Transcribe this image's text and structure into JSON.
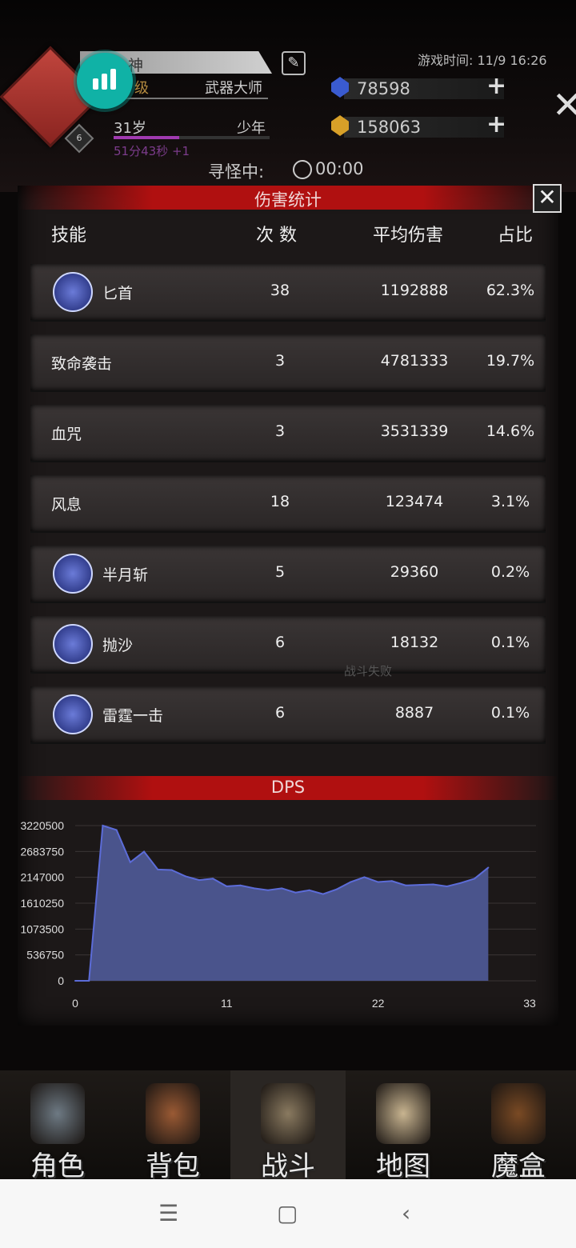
{
  "player": {
    "name": "神",
    "rank": "级",
    "class": "武器大师",
    "age": "31岁",
    "stage": "少年",
    "timer": "51分43秒 +1",
    "level_badge": "6",
    "xp_fraction": 0.42
  },
  "game_time": "游戏时间: 11/9 16:26",
  "resources": [
    {
      "value": "78598",
      "color": "#3a5bd0",
      "icon": "gem-icon"
    },
    {
      "value": "158063",
      "color": "#d8a028",
      "icon": "gold-icon"
    }
  ],
  "search": {
    "label": "寻怪中:",
    "time": "00:00"
  },
  "panel": {
    "title": "伤害统计",
    "headers": {
      "skill": "技能",
      "count": "次 数",
      "avg": "平均伤害",
      "pct": "占比"
    },
    "rows": [
      {
        "name": "匕首",
        "count": "38",
        "avg": "1192888",
        "pct": "62.3%",
        "icon": "dagger-icon"
      },
      {
        "name": "致命袭击",
        "count": "3",
        "avg": "4781333",
        "pct": "19.7%",
        "icon": ""
      },
      {
        "name": "血咒",
        "count": "3",
        "avg": "3531339",
        "pct": "14.6%",
        "icon": ""
      },
      {
        "name": "风息",
        "count": "18",
        "avg": "123474",
        "pct": "3.1%",
        "icon": ""
      },
      {
        "name": "半月斩",
        "count": "5",
        "avg": "29360",
        "pct": "0.2%",
        "icon": "crescent-moon-icon"
      },
      {
        "name": "抛沙",
        "count": "6",
        "avg": "18132",
        "pct": "0.1%",
        "icon": "sand-throw-icon"
      },
      {
        "name": "雷霆一击",
        "count": "6",
        "avg": "8887",
        "pct": "0.1%",
        "icon": "thunder-strike-icon"
      }
    ],
    "watermark": "战斗失败"
  },
  "chart_data": {
    "type": "area",
    "title": "DPS",
    "x": [
      0,
      1,
      2,
      3,
      4,
      5,
      6,
      7,
      8,
      9,
      10,
      11,
      12,
      13,
      14,
      15,
      16,
      17,
      18,
      19,
      20,
      21,
      22,
      23,
      24,
      25,
      26,
      27,
      28,
      29,
      30
    ],
    "values": [
      0,
      0,
      3220500,
      3130000,
      2460000,
      2680000,
      2310000,
      2300000,
      2170000,
      2090000,
      2120000,
      1960000,
      1980000,
      1920000,
      1880000,
      1920000,
      1830000,
      1880000,
      1800000,
      1900000,
      2050000,
      2150000,
      2050000,
      2070000,
      1980000,
      1990000,
      2000000,
      1960000,
      2030000,
      2120000,
      2350000
    ],
    "xticks": [
      "0",
      "11",
      "22",
      "33"
    ],
    "xlim": [
      0,
      33
    ],
    "yticks": [
      "0",
      "536750",
      "1073500",
      "1610250",
      "2147000",
      "2683750",
      "3220500"
    ],
    "ylim": [
      0,
      3220500
    ],
    "fill": "#4a548c",
    "line": "#5c6cd8",
    "grid": true
  },
  "nav": [
    {
      "label": "角色",
      "icon": "helmet-icon",
      "color": "#6e7a84"
    },
    {
      "label": "背包",
      "icon": "backpack-icon",
      "color": "#9a5a34"
    },
    {
      "label": "战斗",
      "icon": "shield-sword-icon",
      "color": "#8a7a60",
      "active": true
    },
    {
      "label": "地图",
      "icon": "scroll-map-icon",
      "color": "#c8b490"
    },
    {
      "label": "魔盒",
      "icon": "magic-box-icon",
      "color": "#7a4a24"
    }
  ],
  "system_nav": {
    "menu": "☰",
    "home": "▢",
    "back": "‹"
  }
}
